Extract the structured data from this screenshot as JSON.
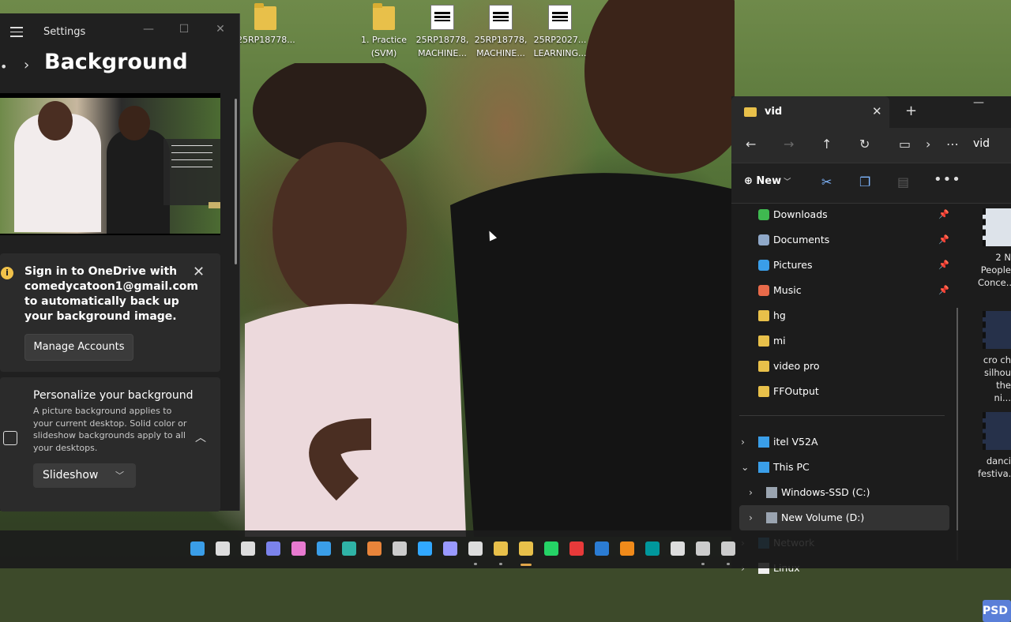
{
  "desktop": {
    "icons": [
      {
        "label": "25RP18778...",
        "type": "folder"
      },
      {
        "label": "1. Practice (SVM)",
        "type": "folder"
      },
      {
        "label": "25RP18778, MACHINE...",
        "type": "doc"
      },
      {
        "label": "25RP18778, MACHINE...",
        "type": "doc"
      },
      {
        "label": "25RP2027... LEARNING...",
        "type": "doc"
      }
    ]
  },
  "settings": {
    "app_title": "Settings",
    "page_title": "Background",
    "breadcrumb_prefix": "•",
    "minimize": "—",
    "maximize": "☐",
    "close": "✕",
    "onedrive": {
      "message": "Sign in to OneDrive with comedycatoon1@gmail.com to automatically back up your background image.",
      "button": "Manage Accounts"
    },
    "personalize": {
      "title": "Personalize your background",
      "description": "A picture background applies to your current desktop. Solid color or slideshow backgrounds apply to all your desktops.",
      "selected": "Slideshow"
    }
  },
  "explorer": {
    "tab_title": "vid",
    "address_current": "vid",
    "new_label": "New",
    "nav_items": [
      {
        "label": "Downloads",
        "icon": "download-icon",
        "pinned": true,
        "color": "#3fb950"
      },
      {
        "label": "Documents",
        "icon": "documents-icon",
        "pinned": true,
        "color": "#8fa8c8"
      },
      {
        "label": "Pictures",
        "icon": "pictures-icon",
        "pinned": true,
        "color": "#3a9ee8"
      },
      {
        "label": "Music",
        "icon": "music-icon",
        "pinned": true,
        "color": "#e86a4a"
      },
      {
        "label": "hg",
        "icon": "folder-icon",
        "pinned": false,
        "color": "#e8c04a"
      },
      {
        "label": "mi",
        "icon": "folder-icon",
        "pinned": false,
        "color": "#e8c04a"
      },
      {
        "label": "video pro",
        "icon": "folder-icon",
        "pinned": false,
        "color": "#e8c04a"
      },
      {
        "label": "FFOutput",
        "icon": "folder-icon",
        "pinned": false,
        "color": "#e8c04a"
      }
    ],
    "tree_items": [
      {
        "label": "itel V52A",
        "icon": "phone-icon",
        "expanded": false,
        "indent": 0
      },
      {
        "label": "This PC",
        "icon": "pc-icon",
        "expanded": true,
        "indent": 0
      },
      {
        "label": "Windows-SSD (C:)",
        "icon": "drive-icon",
        "expanded": false,
        "indent": 1
      },
      {
        "label": "New Volume (D:)",
        "icon": "drive-icon",
        "expanded": false,
        "indent": 1,
        "selected": true
      },
      {
        "label": "Network",
        "icon": "network-icon",
        "expanded": false,
        "indent": 0
      },
      {
        "label": "Linux",
        "icon": "linux-icon",
        "expanded": false,
        "indent": 0
      }
    ],
    "files": [
      {
        "caption": "2 N People Conce..."
      },
      {
        "caption": "cro ch silhou the ni..."
      },
      {
        "caption": "danci festiva..."
      }
    ],
    "psd_badge": "PSD"
  },
  "taskbar": {
    "apps": [
      {
        "name": "start-icon",
        "color": "#3a9ee8"
      },
      {
        "name": "search-icon",
        "color": "#dddddd"
      },
      {
        "name": "task-view-icon",
        "color": "#dddddd"
      },
      {
        "name": "teams-icon",
        "color": "#7b83eb"
      },
      {
        "name": "copilot-icon",
        "color": "#e87ad0"
      },
      {
        "name": "store-icon",
        "color": "#3a9ee8"
      },
      {
        "name": "edge-icon",
        "color": "#2fb3a6"
      },
      {
        "name": "app-orange-icon",
        "color": "#e8843a"
      },
      {
        "name": "settings-gear-icon",
        "color": "#cccccc"
      },
      {
        "name": "photoshop-icon",
        "color": "#31a8ff"
      },
      {
        "name": "premiere-icon",
        "color": "#9999ff"
      },
      {
        "name": "discord-icon",
        "color": "#dddddd"
      },
      {
        "name": "chrome-icon",
        "color": "#e8c04a"
      },
      {
        "name": "file-explorer-icon",
        "color": "#e8c04a"
      },
      {
        "name": "whatsapp-icon",
        "color": "#25d366"
      },
      {
        "name": "wps-icon",
        "color": "#e83a3a"
      },
      {
        "name": "word-icon",
        "color": "#2b7cd3"
      },
      {
        "name": "vlc-icon",
        "color": "#f08a1a"
      },
      {
        "name": "arduino-icon",
        "color": "#00979c"
      },
      {
        "name": "snipping-icon",
        "color": "#dddddd"
      },
      {
        "name": "tool-icon",
        "color": "#cccccc"
      },
      {
        "name": "misc-icon",
        "color": "#cccccc"
      }
    ]
  }
}
